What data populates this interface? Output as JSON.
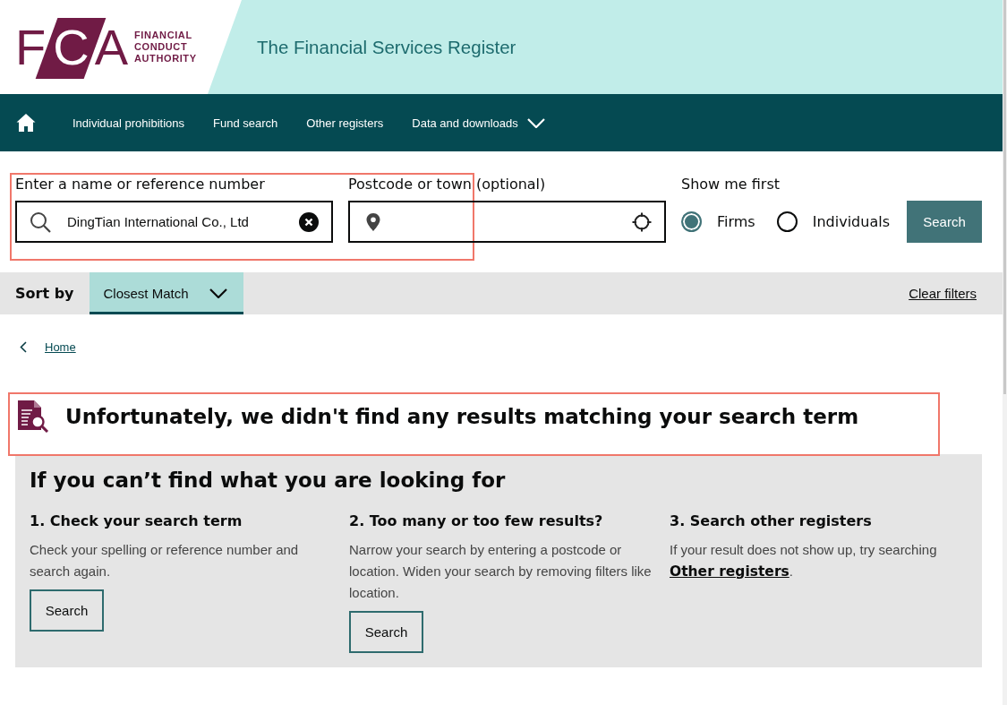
{
  "header": {
    "logo": {
      "mark": "FCA",
      "name_lines": [
        "FINANCIAL",
        "CONDUCT",
        "AUTHORITY"
      ]
    },
    "title": "The Financial Services Register"
  },
  "nav": {
    "items": [
      {
        "label": "Individual prohibitions",
        "has_menu": false
      },
      {
        "label": "Fund search",
        "has_menu": false
      },
      {
        "label": "Other registers",
        "has_menu": false
      },
      {
        "label": "Data and downloads",
        "has_menu": true
      }
    ]
  },
  "search": {
    "highlighted": true,
    "name_field": {
      "label": "Enter a name or reference number",
      "value": "DingTian International Co., Ltd"
    },
    "location_field": {
      "label": "Postcode or town (optional)"
    },
    "show_first": {
      "label": "Show me first",
      "options": [
        {
          "label": "Firms",
          "selected": true
        },
        {
          "label": "Individuals",
          "selected": false
        }
      ]
    },
    "button": "Search"
  },
  "sort": {
    "label": "Sort by",
    "value": "Closest Match",
    "clear": "Clear filters"
  },
  "breadcrumb": [
    {
      "label": "Home"
    }
  ],
  "notice": {
    "highlighted": true,
    "title": "Unfortunately, we didn't find any results matching your search term"
  },
  "help": {
    "title": "If you can’t find what you are looking for",
    "sections": [
      {
        "heading": "1. Check your search term",
        "text": "Check your spelling or reference number and search again.",
        "button": "Search"
      },
      {
        "heading": "2. Too many or too few results?",
        "text": "Narrow your search by entering a postcode or location. Widen your search by removing filters like location.",
        "button": "Search"
      },
      {
        "heading": "3. Search other registers",
        "text": "If your result does not show up, try searching",
        "link": "Other registers",
        "text_after": "."
      }
    ]
  }
}
